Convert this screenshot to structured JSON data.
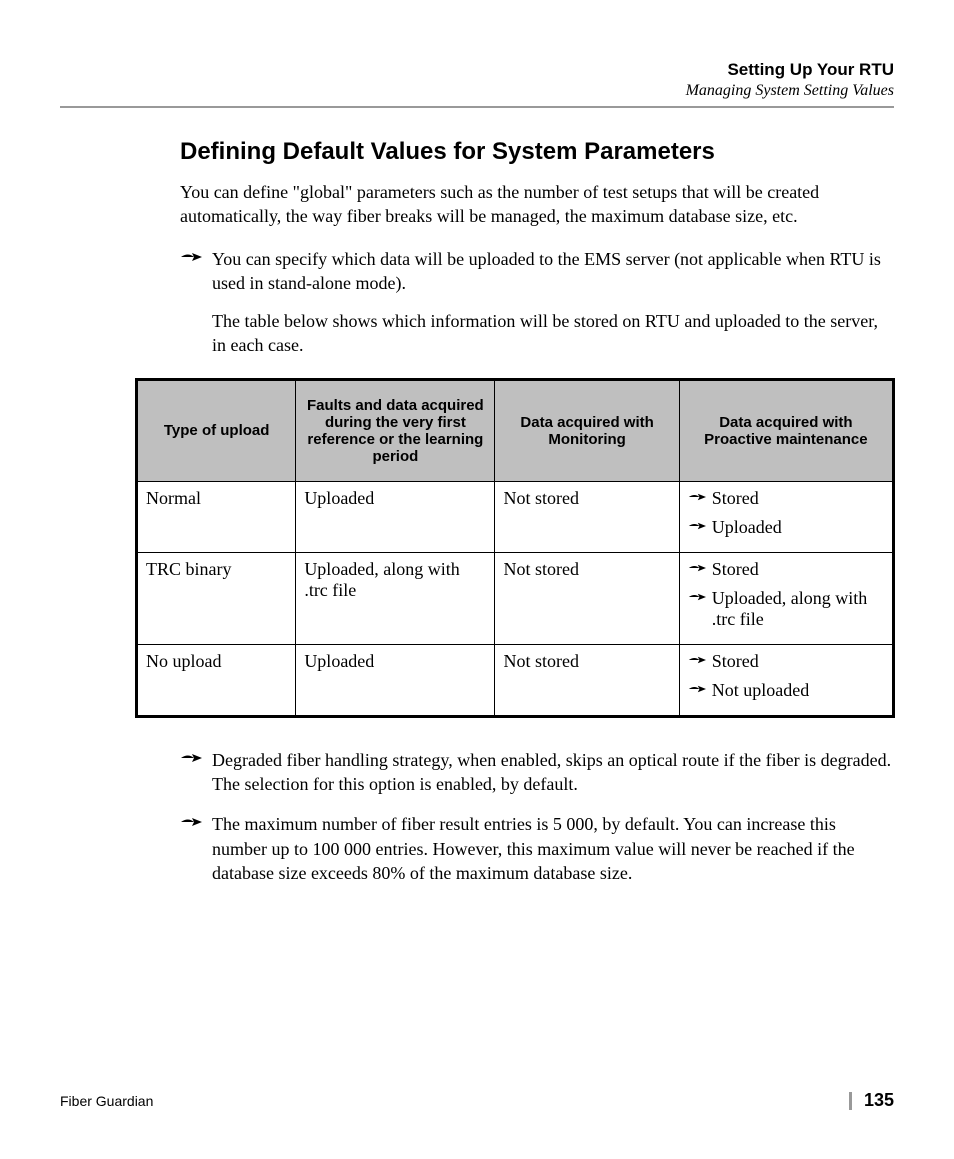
{
  "header": {
    "chapter": "Setting Up Your RTU",
    "section": "Managing System Setting Values"
  },
  "heading": "Defining Default Values for System Parameters",
  "intro": "You can define \"global\" parameters such as the number of test setups that will be created automatically, the way fiber breaks will be managed, the maximum database size, etc.",
  "top_bullet": {
    "p1": "You can specify which data will be uploaded to the EMS server (not applicable when RTU is used in stand-alone mode).",
    "p2": "The table below shows which information will be stored on RTU and uploaded to the server, in each case."
  },
  "table": {
    "headers": {
      "c1": "Type of upload",
      "c2": "Faults and data acquired during the very first reference or the learning period",
      "c3": "Data acquired with Monitoring",
      "c4": "Data acquired with Proactive maintenance"
    },
    "rows": [
      {
        "c1": "Normal",
        "c2": "Uploaded",
        "c3": "Not stored",
        "c4": [
          "Stored",
          "Uploaded"
        ]
      },
      {
        "c1": "TRC binary",
        "c2": "Uploaded, along with .trc file",
        "c3": "Not stored",
        "c4": [
          "Stored",
          "Uploaded, along with .trc file"
        ]
      },
      {
        "c1": "No upload",
        "c2": "Uploaded",
        "c3": "Not stored",
        "c4": [
          "Stored",
          "Not uploaded"
        ]
      }
    ]
  },
  "bottom_bullets": [
    "Degraded fiber handling strategy, when enabled, skips an optical route if the fiber is degraded. The selection for this option is enabled, by default.",
    "The maximum number of fiber result entries is 5 000, by default. You can increase this number up to 100 000 entries. However, this maximum value will never be reached if the database size exceeds 80% of the maximum database size."
  ],
  "footer": {
    "left": "Fiber Guardian",
    "page": "135"
  }
}
